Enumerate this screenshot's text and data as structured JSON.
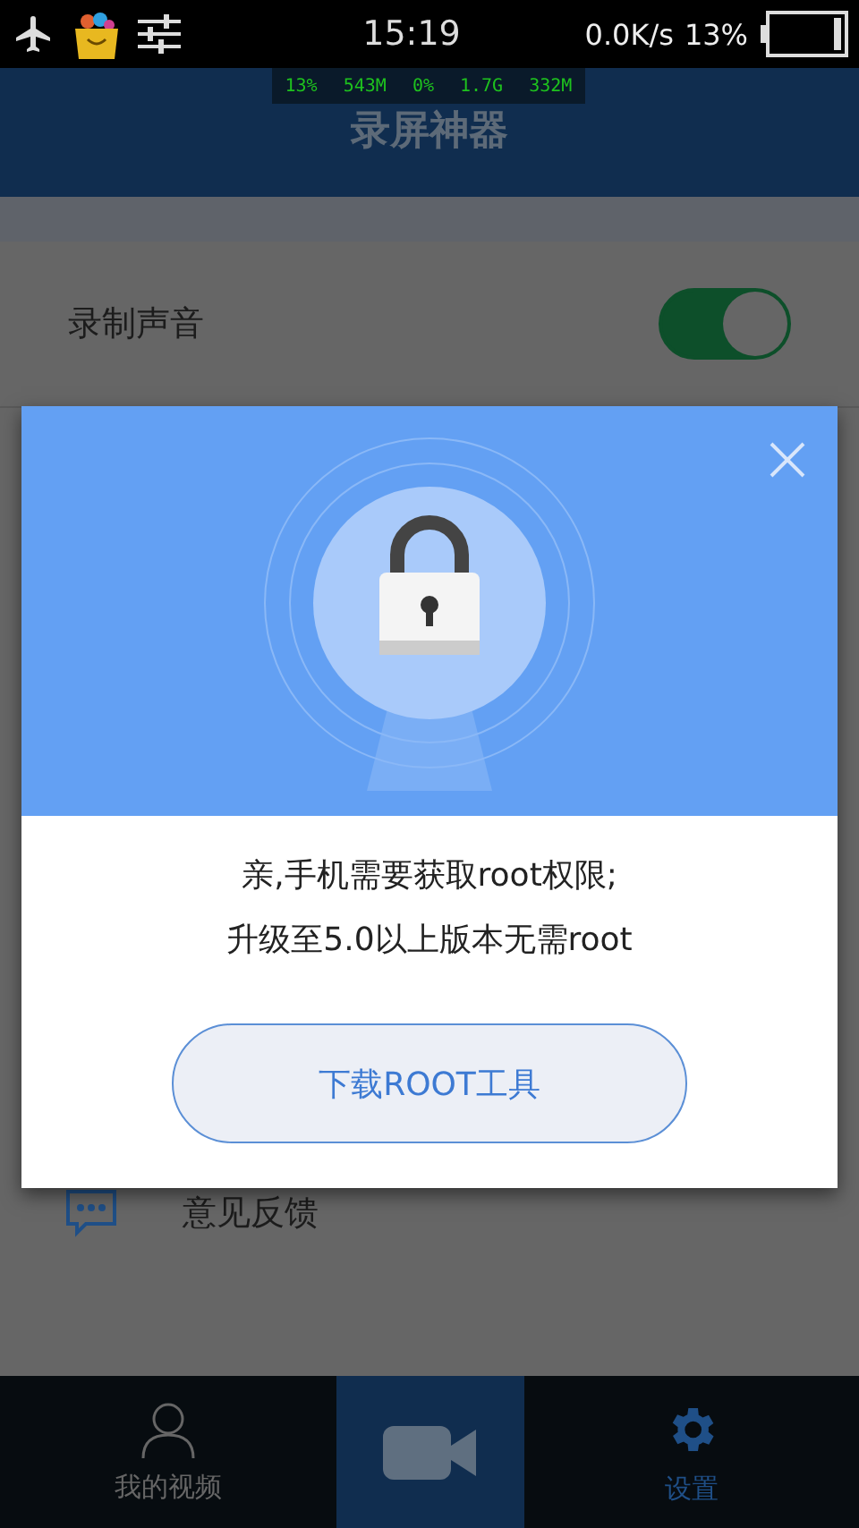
{
  "status_bar": {
    "time": "15:19",
    "net_speed": "0.0K/s",
    "battery_percent": "13%"
  },
  "monitor": [
    "13%",
    "543M",
    "0%",
    "1.7G",
    "332M"
  ],
  "header": {
    "title": "录屏神器"
  },
  "settings": [
    {
      "kind": "toggle",
      "label": "录制声音",
      "on": true
    },
    {
      "kind": "link",
      "label": "意见反馈"
    }
  ],
  "dialog": {
    "lines": [
      "亲,手机需要获取root权限;",
      "升级至5.0以上版本无需root"
    ],
    "button": "下载ROOT工具"
  },
  "nav": [
    {
      "kind": "tab",
      "label": "我的视频",
      "selected": false
    },
    {
      "kind": "record"
    },
    {
      "kind": "settings",
      "label": "设置",
      "selected": true
    }
  ]
}
